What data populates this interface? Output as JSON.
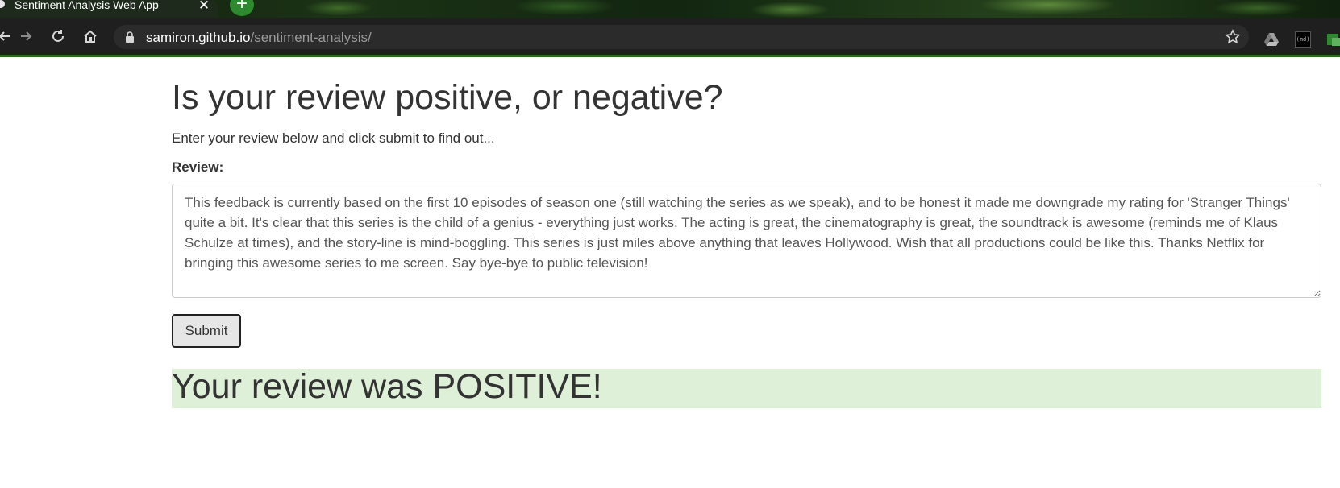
{
  "browser": {
    "tab_title": "Sentiment Analysis Web App",
    "url_host": "samiron.github.io",
    "url_path": "/sentiment-analysis/",
    "icons": [
      "back-icon",
      "forward-icon",
      "reload-icon",
      "home-icon",
      "lock-icon",
      "star-icon",
      "drive-icon",
      "markdown-icon",
      "extension-icon"
    ],
    "md_extension_label": "(md)",
    "accent_color": "#2d6a1f"
  },
  "page": {
    "title": "Is your review positive, or negative?",
    "subtitle": "Enter your review below and click submit to find out...",
    "review_label": "Review:",
    "review_text": "This feedback is currently based on the first 10 episodes of season one (still watching the series as we speak), and to be honest it made me downgrade my rating for 'Stranger Things' quite a bit. It's clear that this series is the child of a genius - everything just works. The acting is great, the cinematography is great, the soundtrack is awesome (reminds me of Klaus Schulze at times), and the story-line is mind-boggling. This series is just miles above anything that leaves Hollywood. Wish that all productions could be like this. Thanks Netflix for bringing this awesome series to me screen. Say bye-bye to public television!",
    "submit_label": "Submit",
    "result_text": "Your review was POSITIVE!",
    "result_bg_color": "#dff0d8"
  }
}
